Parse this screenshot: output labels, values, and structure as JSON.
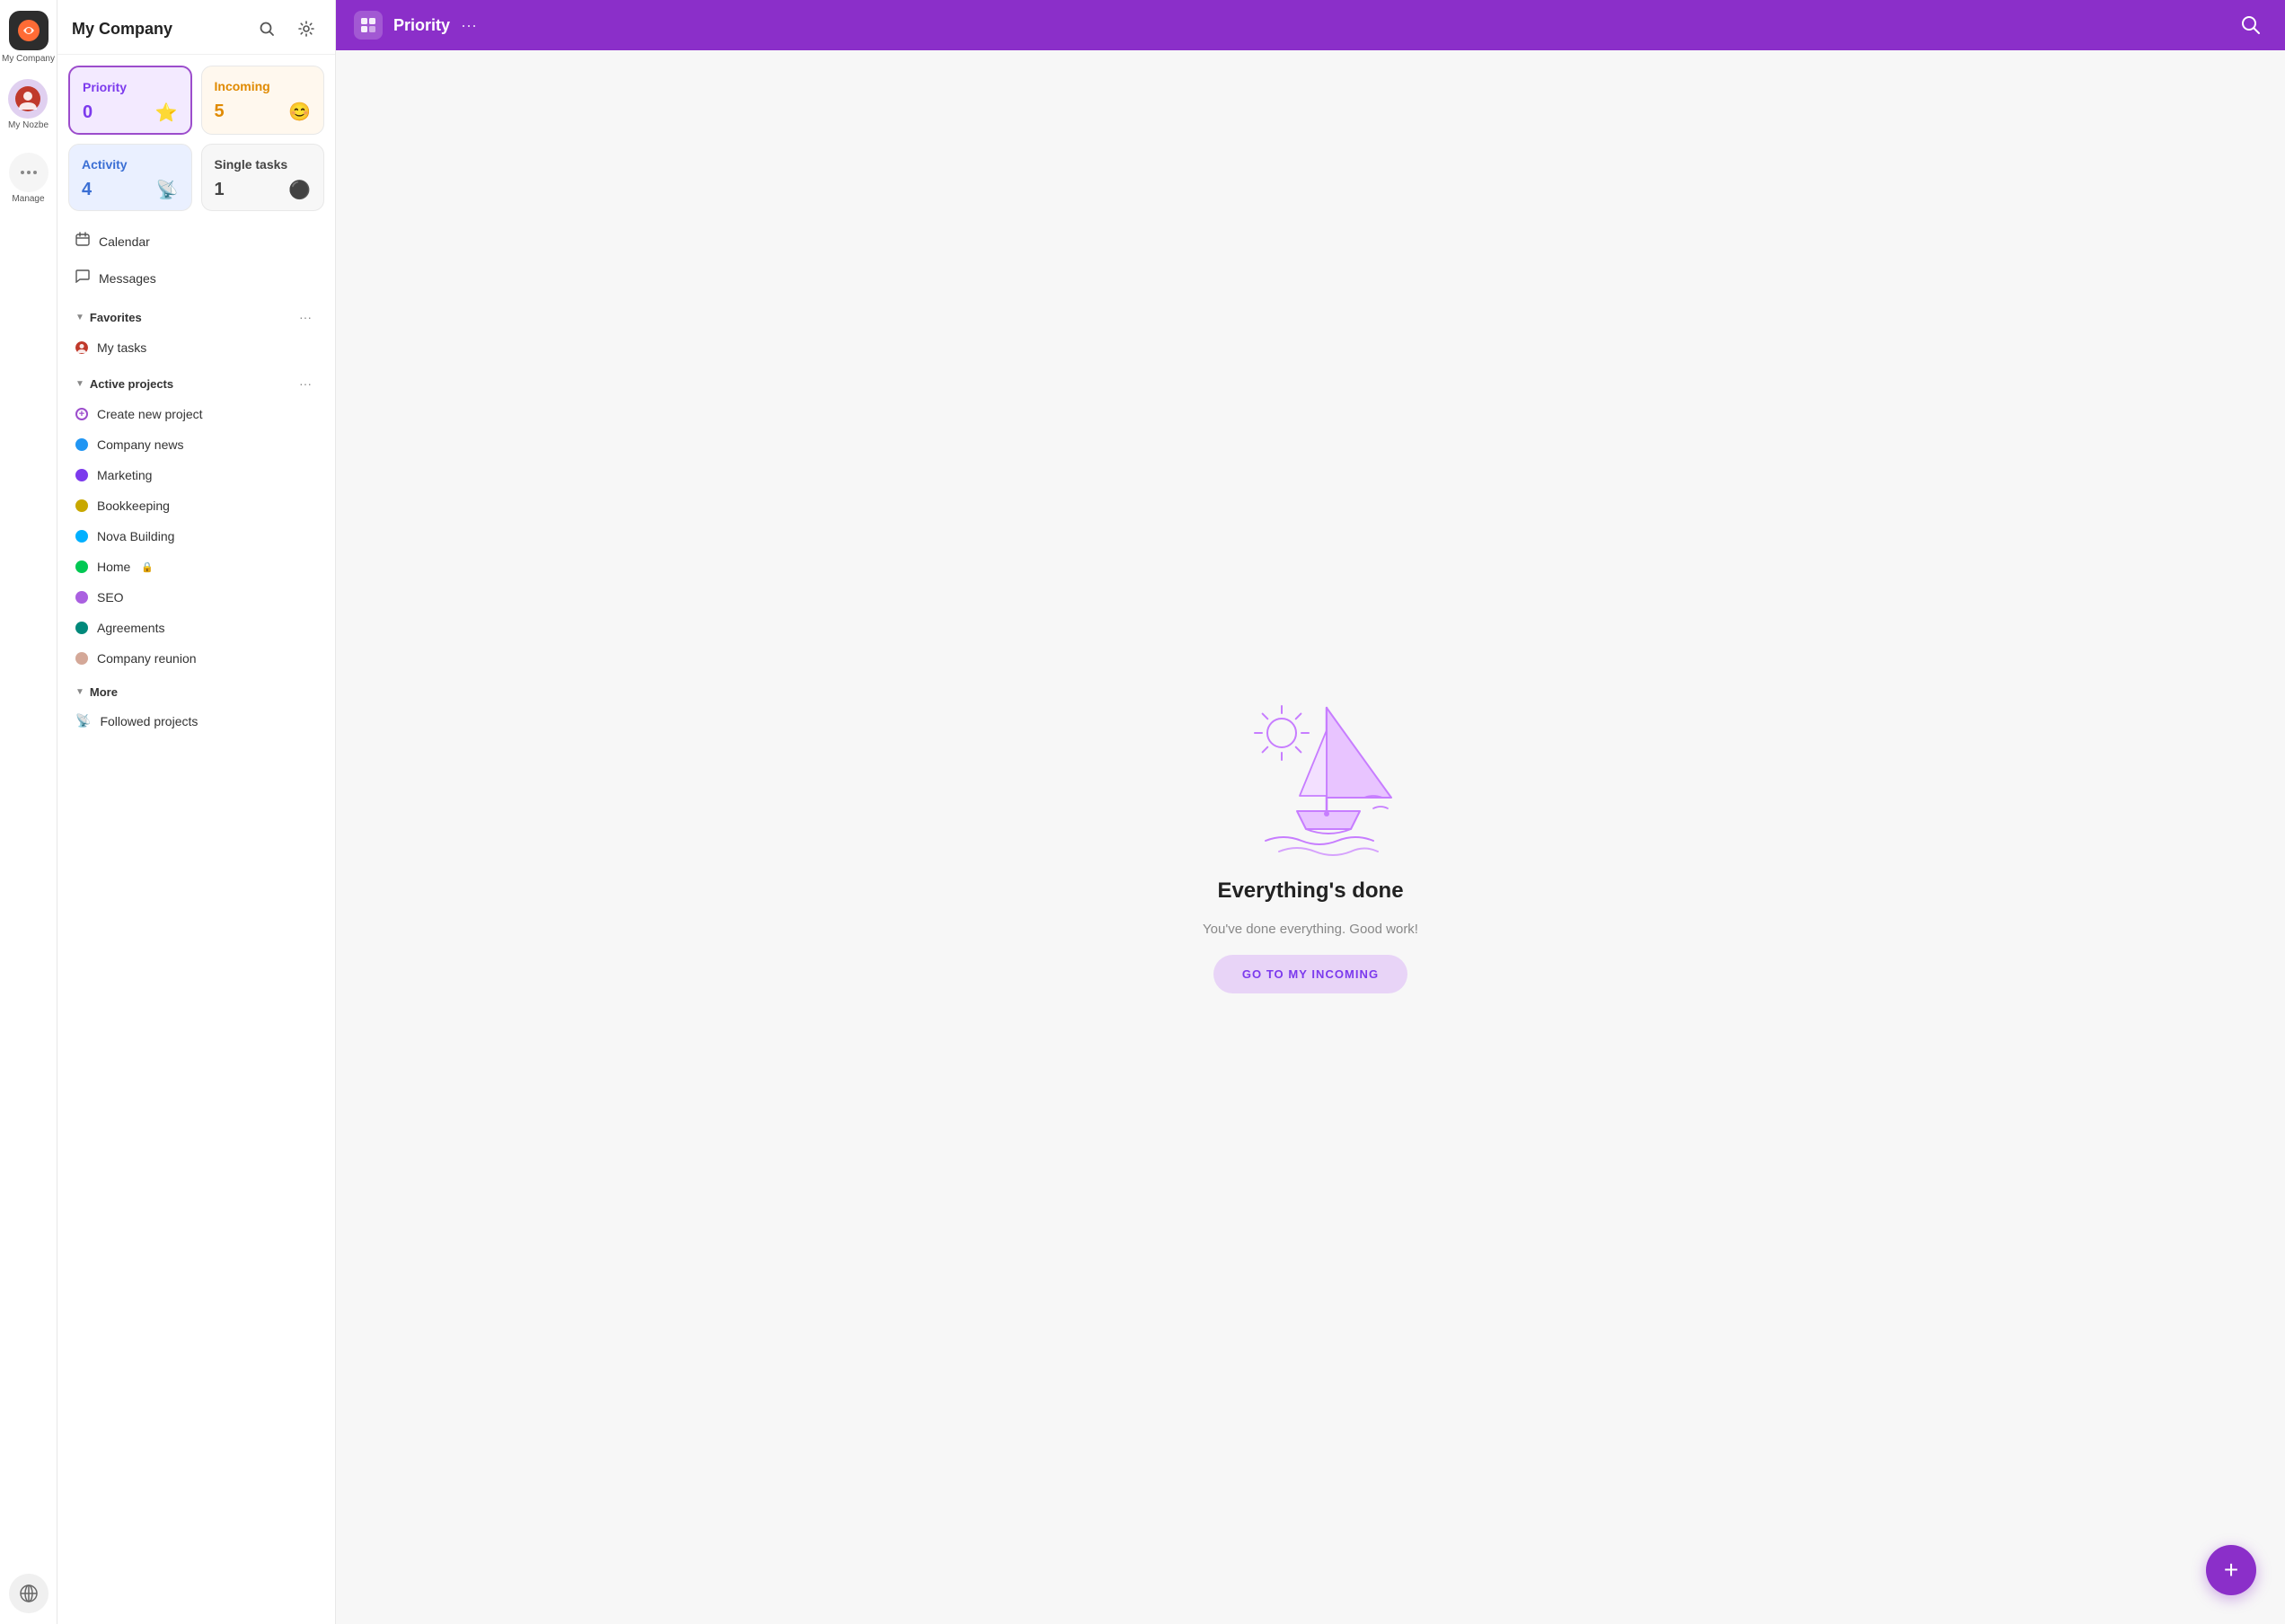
{
  "app": {
    "company_name": "My Company",
    "user_label": "My Nozbe",
    "manage_label": "Manage"
  },
  "header": {
    "title": "Priority",
    "dots": "···",
    "search_icon": "search"
  },
  "sidebar": {
    "title": "My Company",
    "search_tooltip": "Search",
    "settings_tooltip": "Settings",
    "cards": [
      {
        "id": "priority",
        "label": "Priority",
        "count": "0",
        "icon": "⭐"
      },
      {
        "id": "incoming",
        "label": "Incoming",
        "count": "5",
        "icon": "😊"
      },
      {
        "id": "activity",
        "label": "Activity",
        "count": "4",
        "icon": "📡"
      },
      {
        "id": "single-tasks",
        "label": "Single tasks",
        "count": "1",
        "icon": "⚫"
      }
    ],
    "nav_items": [
      {
        "id": "calendar",
        "label": "Calendar",
        "icon": "📅"
      },
      {
        "id": "messages",
        "label": "Messages",
        "icon": "💬"
      }
    ],
    "favorites_section": {
      "label": "Favorites",
      "items": [
        {
          "id": "my-tasks",
          "label": "My tasks",
          "avatar": true
        }
      ]
    },
    "active_projects_section": {
      "label": "Active projects",
      "items": [
        {
          "id": "create-new",
          "label": "Create new project",
          "type": "create",
          "color": "#9c4dcc"
        },
        {
          "id": "company-news",
          "label": "Company news",
          "type": "dot",
          "color": "#2196f3"
        },
        {
          "id": "marketing",
          "label": "Marketing",
          "type": "dot",
          "color": "#7c3aed"
        },
        {
          "id": "bookkeeping",
          "label": "Bookkeeping",
          "type": "dot",
          "color": "#c8a800"
        },
        {
          "id": "nova-building",
          "label": "Nova Building",
          "type": "dot",
          "color": "#00b0ff"
        },
        {
          "id": "home",
          "label": "Home",
          "type": "dot",
          "color": "#00c853",
          "locked": true
        },
        {
          "id": "seo",
          "label": "SEO",
          "type": "dot",
          "color": "#aa60e0"
        },
        {
          "id": "agreements",
          "label": "Agreements",
          "type": "dot",
          "color": "#00897b"
        },
        {
          "id": "company-reunion",
          "label": "Company reunion",
          "type": "dot",
          "color": "#d4a898"
        }
      ]
    },
    "more_section": {
      "label": "More",
      "items": [
        {
          "id": "followed-projects",
          "label": "Followed projects",
          "icon": "📡"
        }
      ]
    }
  },
  "main": {
    "empty_state": {
      "title": "Everything's done",
      "subtitle": "You've done everything. Good work!",
      "button_label": "GO TO MY INCOMING"
    }
  },
  "fab": {
    "label": "+"
  }
}
